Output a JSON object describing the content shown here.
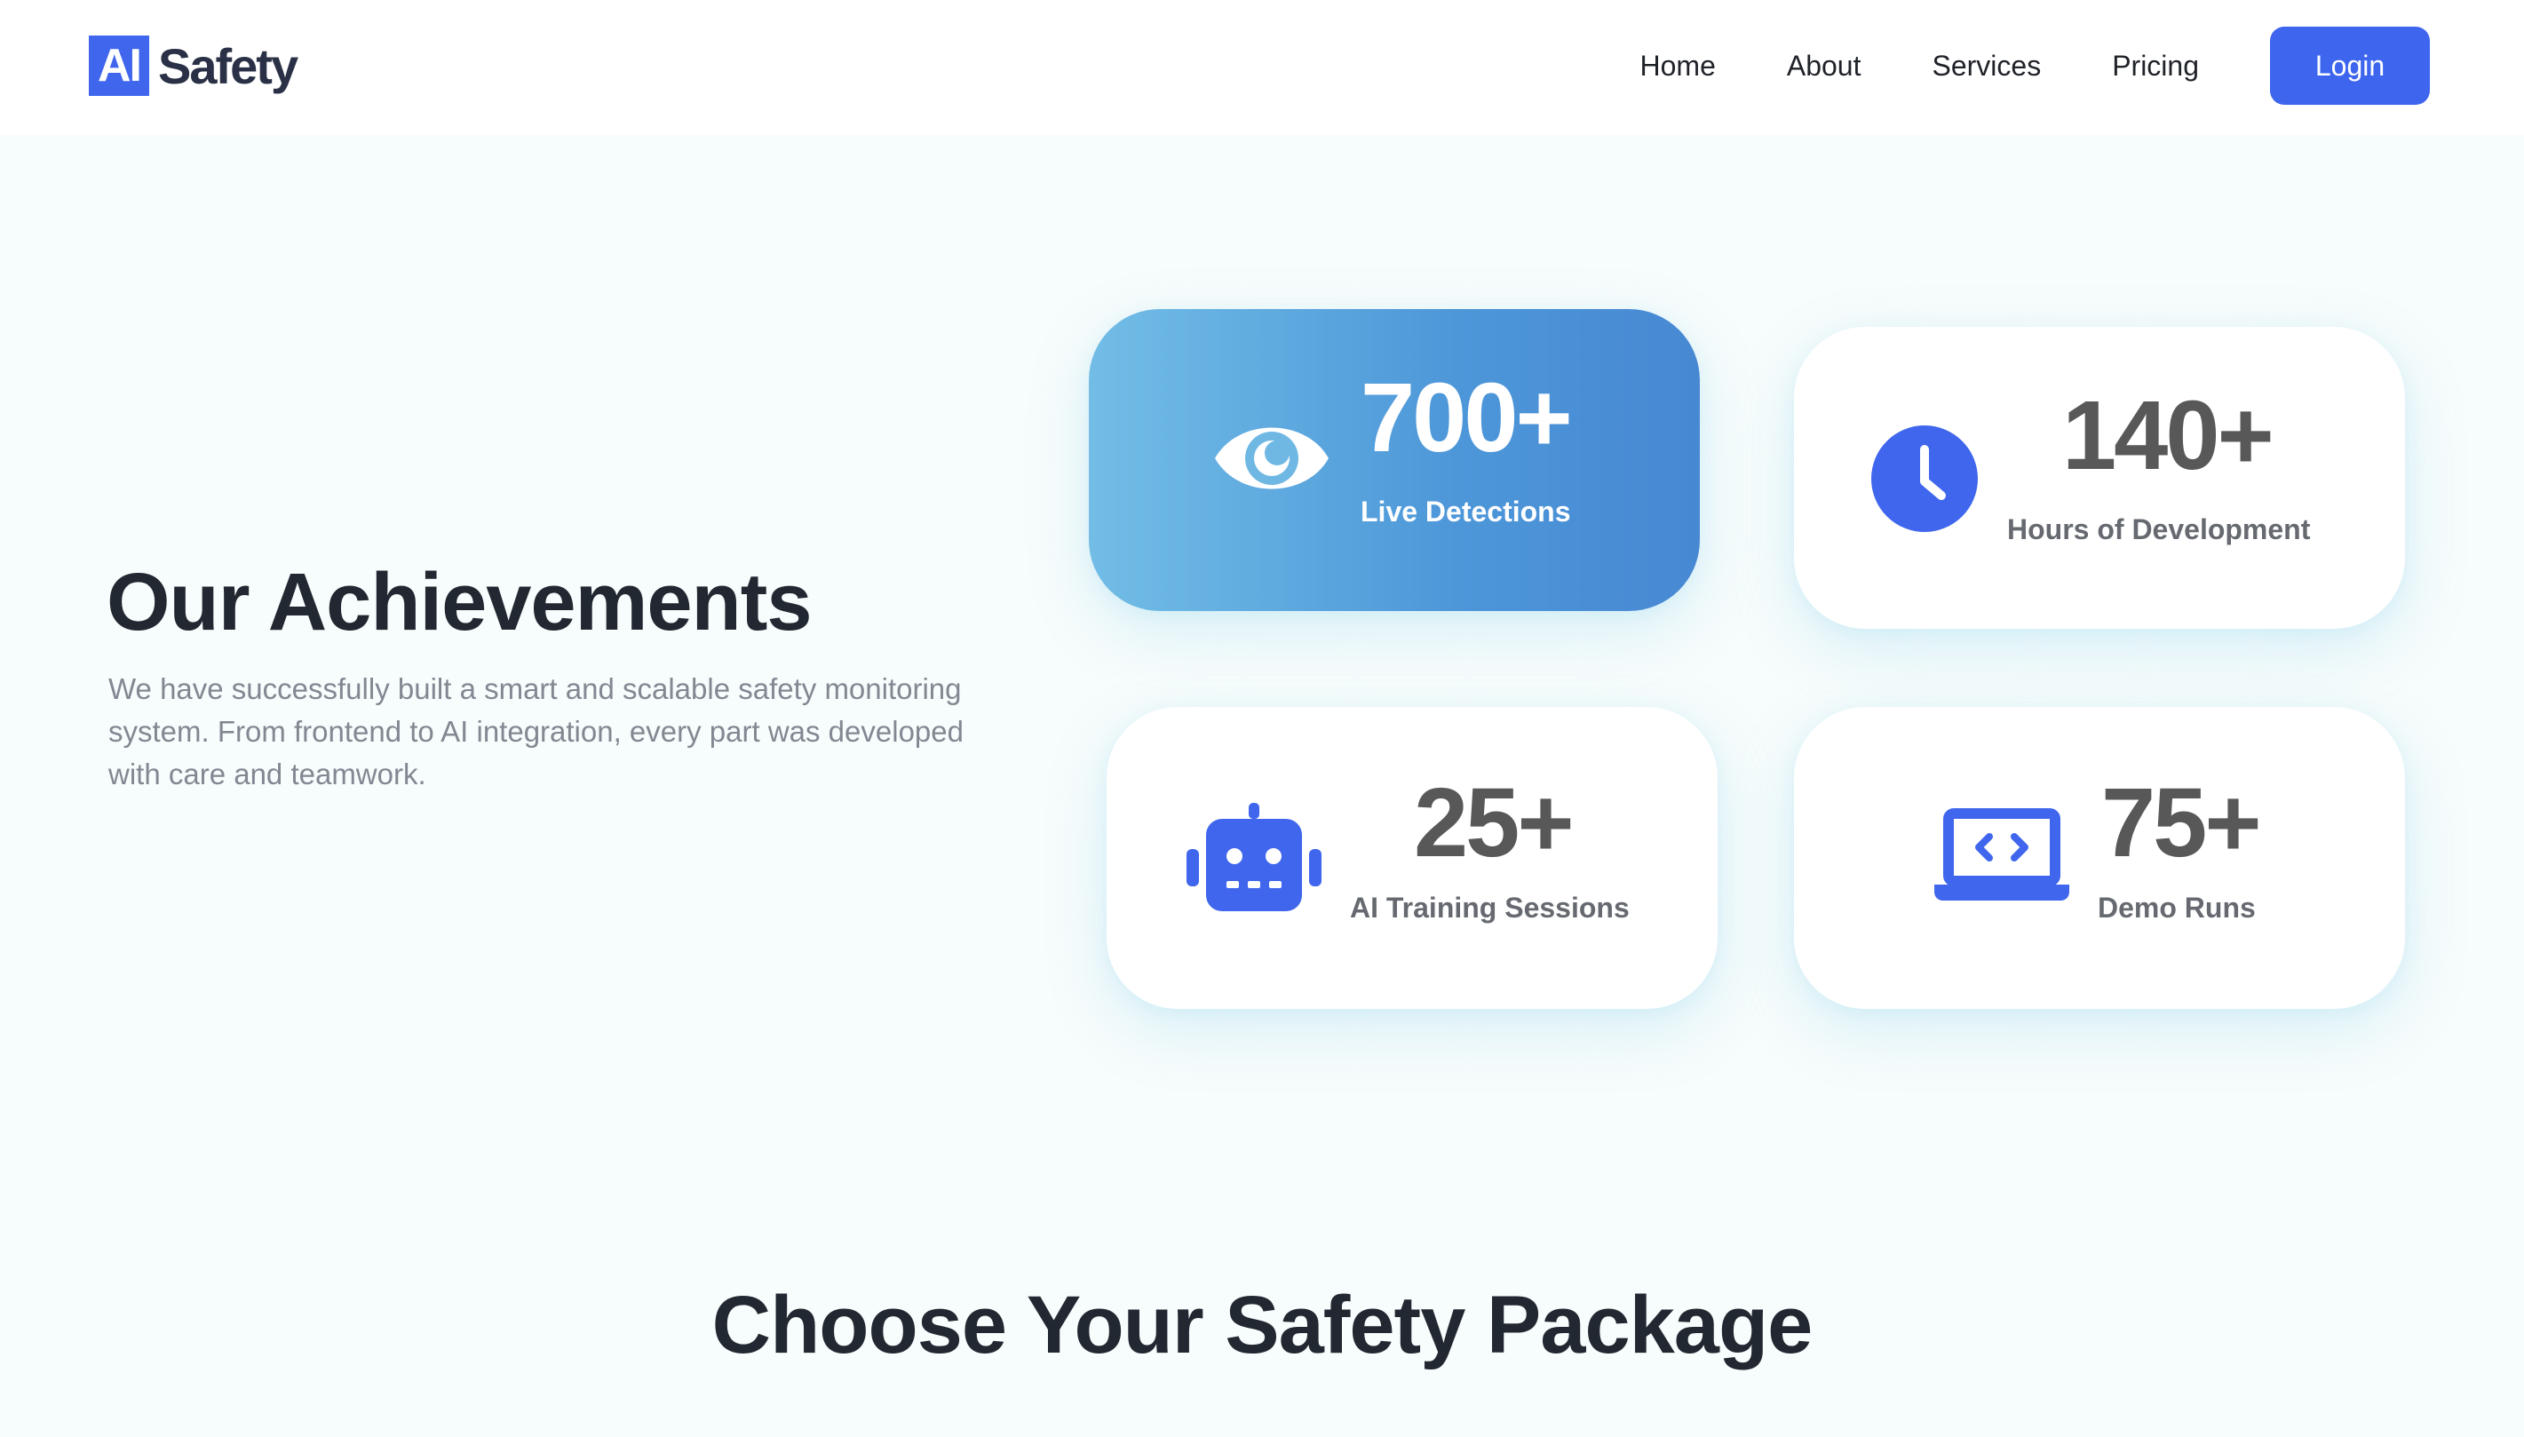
{
  "header": {
    "logo_badge": "AI",
    "logo_text": "Safety",
    "nav": [
      "Home",
      "About",
      "Services",
      "Pricing"
    ],
    "login_label": "Login"
  },
  "achievements": {
    "title": "Our Achievements",
    "description": "We have successfully built a smart and scalable safety monitoring system. From frontend to AI integration, every part was developed with care and teamwork.",
    "stats": [
      {
        "value": "700+",
        "label": "Live Detections",
        "icon": "eye-icon"
      },
      {
        "value": "140+",
        "label": "Hours of Development",
        "icon": "clock-icon"
      },
      {
        "value": "25+",
        "label": "AI Training Sessions",
        "icon": "robot-icon"
      },
      {
        "value": "75+",
        "label": "Demo Runs",
        "icon": "laptop-code-icon"
      }
    ]
  },
  "packages": {
    "title": "Choose Your Safety Package"
  },
  "colors": {
    "accent": "#3e65ee",
    "card_gradient_start": "#72bde6",
    "card_gradient_end": "#4788d3",
    "page_bg": "#f7fcfc"
  }
}
